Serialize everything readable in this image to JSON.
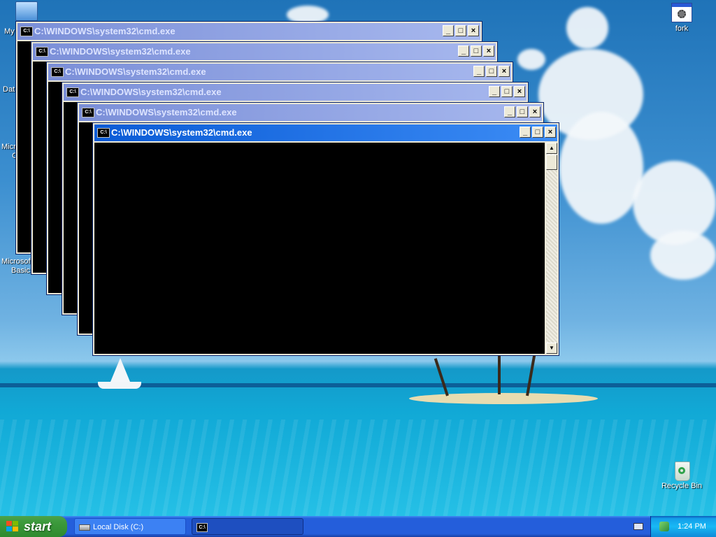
{
  "desktop": {
    "icons": {
      "my_computer_label": "My",
      "data_label": "Dat",
      "microsoft_1_label": "Micro",
      "microsoft_1_line2": "C",
      "microsoft_2_label": "Microsoft",
      "microsoft_2_line2": "Basic",
      "fork_label": "fork",
      "recycle_bin_label": "Recycle Bin"
    }
  },
  "windows": [
    {
      "title": "C:\\WINDOWS\\system32\\cmd.exe",
      "icon": "cmd-icon"
    },
    {
      "title": "C:\\WINDOWS\\system32\\cmd.exe",
      "icon": "cmd-icon"
    },
    {
      "title": "C:\\WINDOWS\\system32\\cmd.exe",
      "icon": "cmd-icon"
    },
    {
      "title": "C:\\WINDOWS\\system32\\cmd.exe",
      "icon": "cmd-icon"
    },
    {
      "title": "C:\\WINDOWS\\system32\\cmd.exe",
      "icon": "cmd-icon"
    },
    {
      "title": "C:\\WINDOWS\\system32\\cmd.exe",
      "icon": "cmd-icon"
    }
  ],
  "window_icon_text": "C:\\",
  "title_buttons": {
    "minimize": "_",
    "maximize": "□",
    "close": "×"
  },
  "taskbar": {
    "start_label": "start",
    "tasks": [
      {
        "label": "Local Disk (C:)",
        "icon": "drive-icon"
      },
      {
        "label": "",
        "icon": "cmd-icon"
      }
    ],
    "clock": "1:24 PM"
  },
  "colors": {
    "active_title": "#0a5bd6",
    "inactive_title": "#7b8fd8",
    "taskbar": "#245edb",
    "start_button": "#3c9a3c",
    "tray": "#18b9f5"
  }
}
